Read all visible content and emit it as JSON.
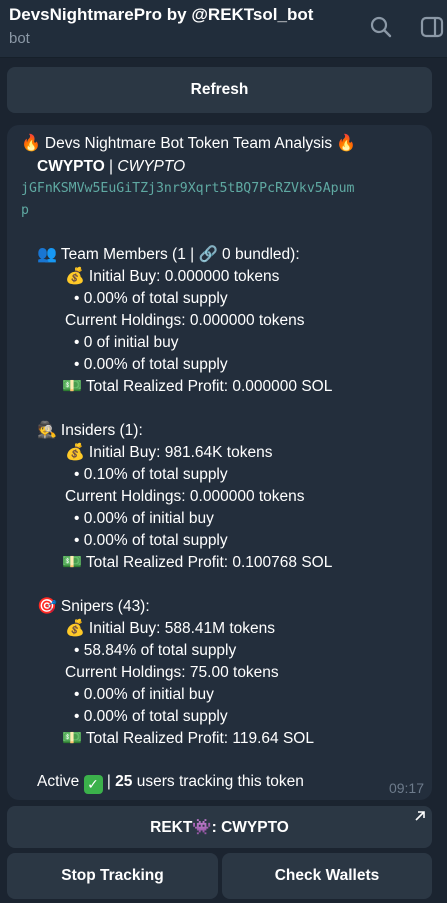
{
  "header": {
    "title": "DevsNightmarePro by @REKTsol_bot",
    "subtitle": "bot"
  },
  "keyboard_top": {
    "refresh_label": "Refresh"
  },
  "message": {
    "title": "Devs Nightmare Bot Token Team Analysis",
    "token_name": "CWYPTO",
    "token_symbol": "CWYPTO",
    "address_line1": "jGFnKSMVw5EuGiTZj3nr9Xqrt5tBQ7PcRZVkv5Apum",
    "address_line2": "p",
    "team": {
      "heading": "Team Members (1 | 🔗 0 bundled):",
      "initial_buy": "Initial Buy: 0.000000 tokens",
      "supply_pct": "• 0.00% of total supply",
      "current": "Current Holdings: 0.000000 tokens",
      "of_initial": "• 0 of initial buy",
      "cur_supply": "• 0.00% of total supply",
      "profit": "Total Realized Profit: 0.000000 SOL"
    },
    "insiders": {
      "heading": "Insiders (1):",
      "initial_buy": "Initial Buy: 981.64K tokens",
      "supply_pct": "• 0.10% of total supply",
      "current": "Current Holdings: 0.000000 tokens",
      "of_initial": "• 0.00% of initial buy",
      "cur_supply": "• 0.00% of total supply",
      "profit": "Total Realized Profit: 0.100768 SOL"
    },
    "snipers": {
      "heading": "Snipers (43):",
      "initial_buy": "Initial Buy: 588.41M tokens",
      "supply_pct": "• 58.84% of total supply",
      "current": "Current Holdings: 75.00 tokens",
      "of_initial": "• 0.00% of initial buy",
      "cur_supply": "• 0.00% of total supply",
      "profit": "Total Realized Profit: 119.64 SOL"
    },
    "active_label": "Active",
    "users_count": "25",
    "users_suffix": "users tracking this token",
    "time": "09:17"
  },
  "keyboard": {
    "rekt_label": "REKT👾: CWYPTO",
    "stop_label": "Stop Tracking",
    "check_label": "Check Wallets"
  },
  "colors": {
    "background": "#1b2430",
    "bubble": "#232e3c",
    "button": "#2b3744",
    "address": "#5fa9a2",
    "muted": "#8b98a6"
  }
}
